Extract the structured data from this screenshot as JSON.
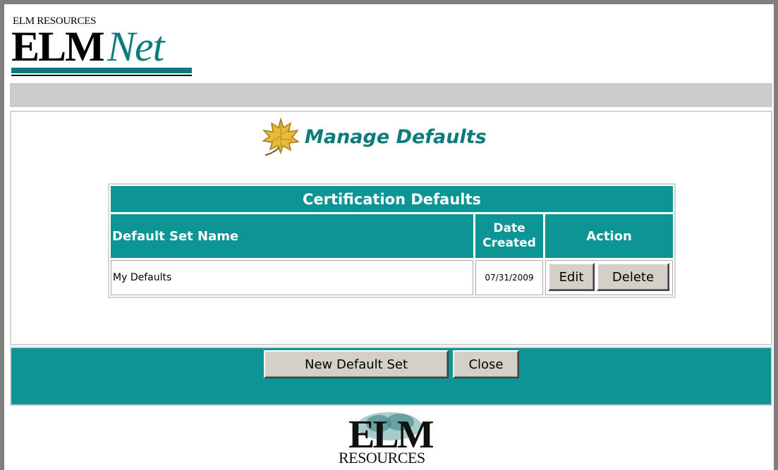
{
  "header": {
    "logo_small": "ELM RESOURCES",
    "logo_elm": "ELM",
    "logo_net": "Net"
  },
  "page": {
    "title": "Manage Defaults"
  },
  "table": {
    "title": "Certification Defaults",
    "columns": {
      "name": "Default Set Name",
      "date": "Date Created",
      "action": "Action"
    },
    "rows": [
      {
        "name": "My Defaults",
        "date": "07/31/2009",
        "edit": "Edit",
        "delete": "Delete"
      }
    ]
  },
  "footer_buttons": {
    "new_set": "New Default Set",
    "close": "Close"
  },
  "bottom_logo": {
    "elm": "ELM",
    "resources": "RESOURCES"
  },
  "colors": {
    "teal": "#0d9595",
    "dark_teal": "#0d7b7b",
    "gray_bar": "#cccccc"
  },
  "icons": {
    "title_icon": "maple-leaf-icon"
  }
}
